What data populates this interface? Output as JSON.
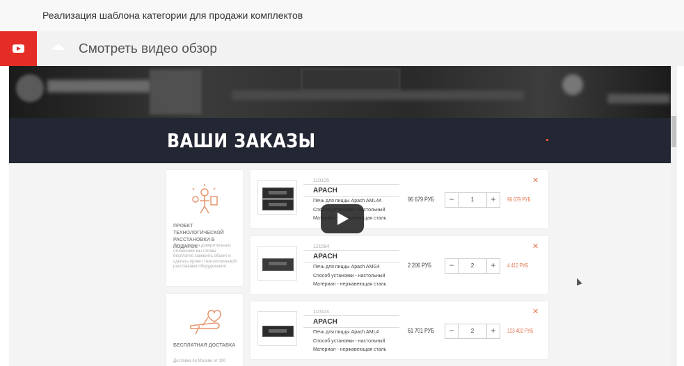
{
  "header": {
    "title": "Реализация шаблона категории для продажи комплектов"
  },
  "video_section": {
    "label": "Смотреть видео обзор"
  },
  "video_frame": {
    "banner_title": "ВАШИ ЗАКАЗЫ",
    "side_cards": [
      {
        "title": "ПРОЕКТ ТЕХНОЛОГИЧЕСКОЙ РАССТАНОВКИ В ПОДАРОК",
        "desc": "Для создания доверительных отношений мы готовы бесплатно замерить объект и сделать проект технологической расстановки оборудования"
      },
      {
        "title": "БЕСПЛАТНАЯ ДОСТАВКА",
        "desc": "Доставка по Москве от 100"
      }
    ],
    "items": [
      {
        "sku": "110105",
        "brand": "APACH",
        "name": "Печь для пиццы Apach AML44",
        "mount": "Способ установки - настольный",
        "material": "Материал - нержавеющая сталь",
        "price": "96 679 РУБ",
        "qty": "1",
        "total": "96 679 РУБ",
        "remove": "✕"
      },
      {
        "sku": "121584",
        "brand": "APACH",
        "name": "Печь для пиццы Apach AMG4",
        "mount": "Способ установки - настольный",
        "material": "Материал - нержавеющая сталь",
        "price": "2 206 РУБ",
        "qty": "2",
        "total": "4 412 РУБ",
        "remove": "✕"
      },
      {
        "sku": "110104",
        "brand": "APACH",
        "name": "Печь для пиццы Apach AML4",
        "mount": "Способ установки - настольный",
        "material": "Материал - нержавеющая сталь",
        "price": "61 701 РУБ",
        "qty": "2",
        "total": "123 402 РУБ",
        "remove": "✕"
      }
    ],
    "qty_minus": "−",
    "qty_plus": "+"
  },
  "colors": {
    "youtube_red": "#e52d27",
    "banner_bg": "#232633",
    "accent": "#e0734f"
  }
}
